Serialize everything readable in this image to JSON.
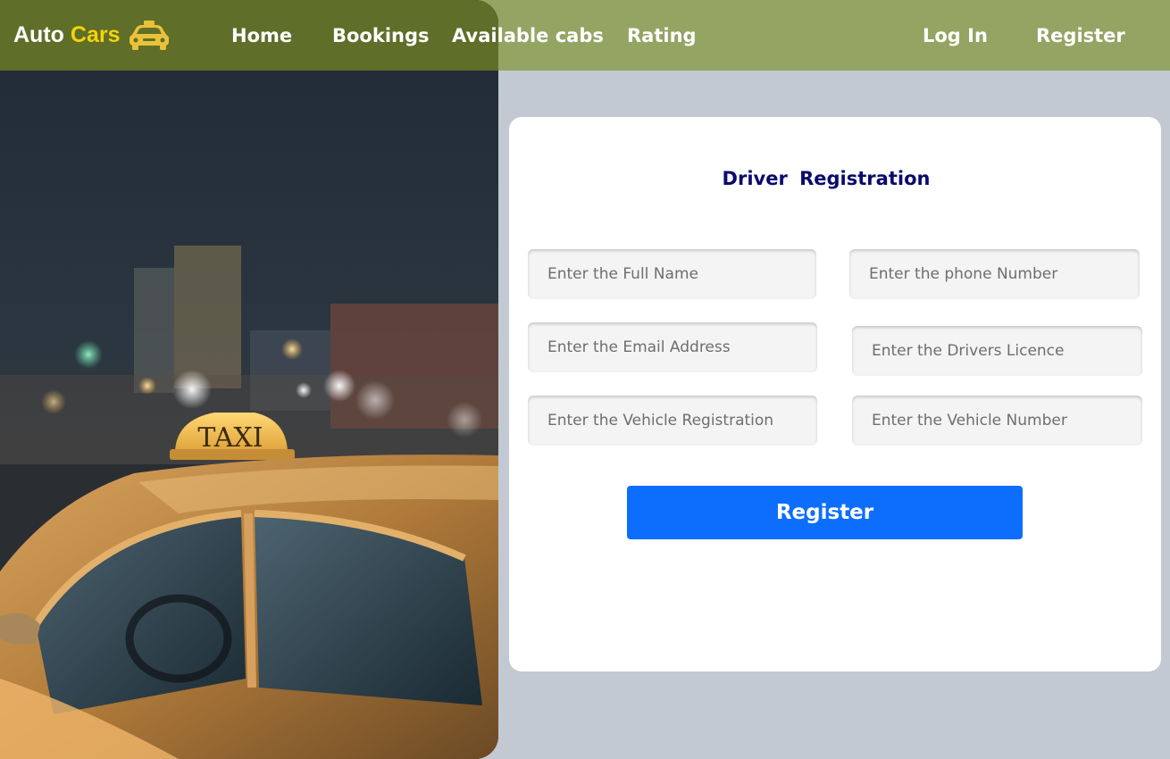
{
  "brand": {
    "name_main": "Auto",
    "name_accent": "Cars",
    "icon": "taxi-car-icon",
    "accent_color": "#f6d20a"
  },
  "nav": {
    "home": "Home",
    "bookings": "Bookings",
    "available_cabs": "Available cabs",
    "rating": "Rating",
    "login": "Log In",
    "register": "Register"
  },
  "hero": {
    "image": "night-street-taxi-photo",
    "roof_sign": "TAXI"
  },
  "form": {
    "title": "Driver  Registration",
    "full_name_placeholder": "Enter the Full Name",
    "phone_placeholder": "Enter the phone Number",
    "email_placeholder": "Enter the Email Address",
    "licence_placeholder": "Enter the Drivers Licence",
    "vehicle_registration_placeholder": "Enter the Vehicle Registration",
    "vehicle_number_placeholder": "Enter the Vehicle Number",
    "submit_label": "Register",
    "submit_color": "#0d6efd"
  },
  "colors": {
    "header_bg": "#94a463",
    "header_overlay": "#5f6e28",
    "page_bg": "#c2c9d2",
    "title_color": "#0a0a6e"
  }
}
